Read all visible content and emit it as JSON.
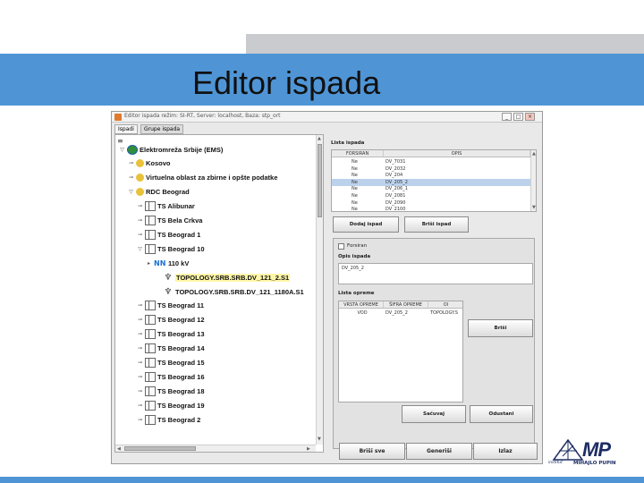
{
  "slide": {
    "title": "Editor ispada"
  },
  "window": {
    "title": "Editor ispada  režim: SI-RT,  Server: localhost,  Baza: stp_ort",
    "controls": [
      "_",
      "□",
      "×"
    ]
  },
  "tabs": [
    {
      "label": "Ispadi",
      "active": true
    },
    {
      "label": "Grupe ispada",
      "active": false
    }
  ],
  "tree": {
    "nodes": [
      {
        "label": "Elektromreža Srbije (EMS)",
        "toggle": "▽",
        "icon": "globe-icon",
        "level": 0
      },
      {
        "label": "Kosovo",
        "toggle": "⊸",
        "icon": "region-icon",
        "level": 1
      },
      {
        "label": "Virtuelna oblast za zbirne i opšte podatke",
        "toggle": "⊸",
        "icon": "region-icon",
        "level": 1
      },
      {
        "label": "RDC Beograd",
        "toggle": "▽",
        "icon": "region-icon",
        "level": 1
      },
      {
        "label": "TS Alibunar",
        "toggle": "⊸",
        "icon": "substation-icon",
        "level": 2
      },
      {
        "label": "TS Bela Crkva",
        "toggle": "⊸",
        "icon": "substation-icon",
        "level": 2
      },
      {
        "label": "TS Beograd 1",
        "toggle": "⊸",
        "icon": "substation-icon",
        "level": 2
      },
      {
        "label": "TS Beograd 10",
        "toggle": "▽",
        "icon": "substation-icon",
        "level": 2
      },
      {
        "label": "110 kV",
        "toggle": "▸",
        "icon": "voltage-level-icon",
        "level": 3
      },
      {
        "label": "TOPOLOGY.SRB.SRB.DV_121_2.S1",
        "toggle": "",
        "icon": "tower-icon",
        "level": 4,
        "selected": true
      },
      {
        "label": "TOPOLOGY.SRB.SRB.DV_121_1180A.S1",
        "toggle": "",
        "icon": "tower-icon",
        "level": 4
      },
      {
        "label": "TS Beograd 11",
        "toggle": "⊸",
        "icon": "substation-icon",
        "level": 2
      },
      {
        "label": "TS Beograd 12",
        "toggle": "⊸",
        "icon": "substation-icon",
        "level": 2
      },
      {
        "label": "TS Beograd 13",
        "toggle": "⊸",
        "icon": "substation-icon",
        "level": 2
      },
      {
        "label": "TS Beograd 14",
        "toggle": "⊸",
        "icon": "substation-icon",
        "level": 2
      },
      {
        "label": "TS Beograd 15",
        "toggle": "⊸",
        "icon": "substation-icon",
        "level": 2
      },
      {
        "label": "TS Beograd 16",
        "toggle": "⊸",
        "icon": "substation-icon",
        "level": 2
      },
      {
        "label": "TS Beograd 18",
        "toggle": "⊸",
        "icon": "substation-icon",
        "level": 2
      },
      {
        "label": "TS Beograd 19",
        "toggle": "⊸",
        "icon": "substation-icon",
        "level": 2
      },
      {
        "label": "TS Beograd 2",
        "toggle": "⊸",
        "icon": "substation-icon",
        "level": 2
      }
    ]
  },
  "outage_list": {
    "label": "Lista ispada",
    "columns": [
      "FORSIRAN",
      "OPIS"
    ],
    "rows": [
      {
        "forsiran": "Ne",
        "opis": "DV_7031"
      },
      {
        "forsiran": "Ne",
        "opis": "DV_2032"
      },
      {
        "forsiran": "Ne",
        "opis": "DV_204"
      },
      {
        "forsiran": "Ne",
        "opis": "DV_205_2",
        "selected": true
      },
      {
        "forsiran": "Ne",
        "opis": "DV_206_1"
      },
      {
        "forsiran": "Ne",
        "opis": "DV_2081"
      },
      {
        "forsiran": "Ne",
        "opis": "DV_2090"
      },
      {
        "forsiran": "Ne",
        "opis": "DV_2100"
      }
    ],
    "add_button": "Dodaj ispad",
    "delete_button": "Briši ispad"
  },
  "detail": {
    "forced_label": "Forsiran",
    "description_label": "Opis ispada",
    "description_value": "DV_205_2",
    "equipment_label": "Lista opreme",
    "equipment_columns": [
      "VRSTA OPREME",
      "ŠIFRA OPREME",
      "OI"
    ],
    "equipment_rows": [
      {
        "type": "VOD",
        "code": "DV_205_2",
        "other": "TOPOLOGY.S"
      }
    ],
    "delete_button": "Briši",
    "save_button": "Sačuvaj",
    "cancel_button": "Odustani"
  },
  "footer": {
    "delete_all": "Briši sve",
    "generate": "Generiši",
    "exit": "Izlaz"
  },
  "logo": {
    "mark": "MP",
    "name": "MIHAJLO PUPIN",
    "institute": "institut"
  },
  "colors": {
    "header_blue": "#4f95d6",
    "header_gray": "#c9cbce",
    "selection": "#bcd2ec",
    "logo_navy": "#1d2d63"
  }
}
